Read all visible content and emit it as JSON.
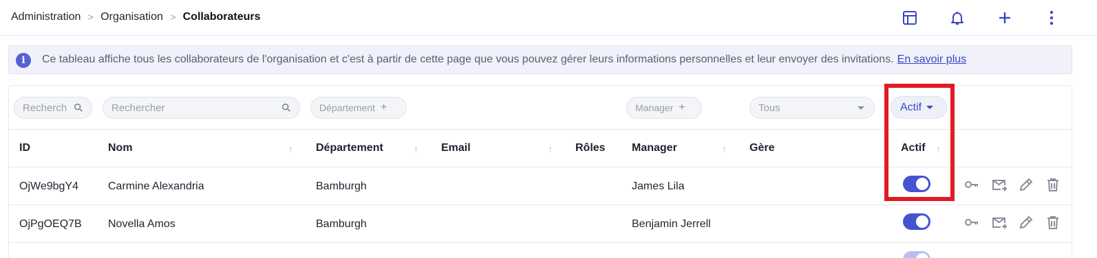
{
  "breadcrumb": {
    "items": [
      "Administration",
      "Organisation"
    ],
    "current": "Collaborateurs",
    "separator": ">"
  },
  "toolbar": {
    "icons": [
      "table-layout-icon",
      "bell-icon",
      "plus-icon",
      "more-vertical-icon"
    ],
    "accent": "#3a47c4"
  },
  "info_banner": {
    "text": "Ce tableau affiche tous les collaborateurs de l'organisation et c'est à partir de cette page que vous pouvez gérer leurs informations personnelles et leur envoyer des invitations.",
    "link": "En savoir plus",
    "icon": "info-icon"
  },
  "filters": {
    "id_placeholder": "Recherch",
    "name_placeholder": "Rechercher",
    "department": "Département",
    "manager": "Manager",
    "manages": "Tous",
    "active": "Actif",
    "add_symbol": "+"
  },
  "columns": [
    "ID",
    "Nom",
    "Département",
    "Email",
    "Rôles",
    "Manager",
    "Gère",
    "Actif"
  ],
  "sort_arrow": "↑",
  "rows": [
    {
      "id": "OjWe9bgY4",
      "name": "Carmine Alexandria",
      "department": "Bamburgh",
      "email": "",
      "roles": "",
      "manager": "James Lila",
      "manages": "",
      "active": true
    },
    {
      "id": "OjPgOEQ7B",
      "name": "Novella Amos",
      "department": "Bamburgh",
      "email": "",
      "roles": "",
      "manager": "Benjamin Jerrell",
      "manages": "",
      "active": true
    }
  ],
  "row_actions": [
    "key-icon",
    "send-mail-icon",
    "edit-pencil-icon",
    "trash-icon"
  ],
  "colors": {
    "toggle_on": "#4453d1",
    "highlight": "#e01b24",
    "banner_bg": "#f0f1fa"
  }
}
